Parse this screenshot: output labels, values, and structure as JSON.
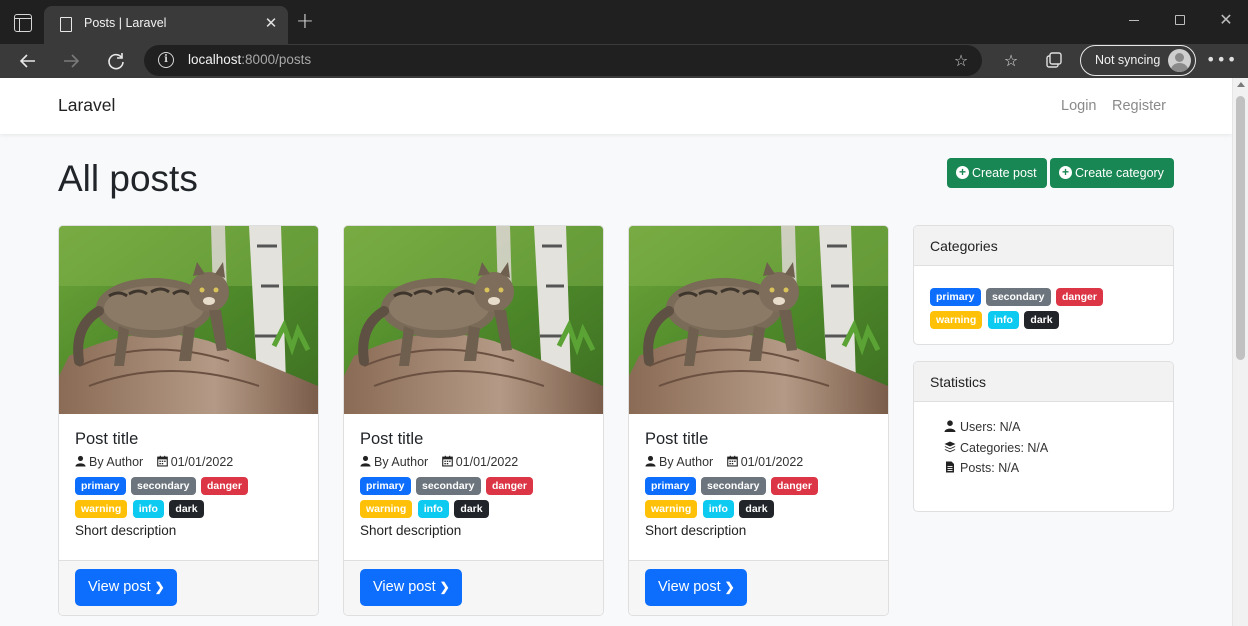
{
  "browser": {
    "tab_title": "Posts | Laravel",
    "url_host": "localhost",
    "url_rest": ":8000/posts",
    "profile_label": "Not syncing"
  },
  "navbar": {
    "brand": "Laravel",
    "login": "Login",
    "register": "Register"
  },
  "page": {
    "title": "All posts",
    "create_post": "Create post",
    "create_category": "Create category"
  },
  "posts": [
    {
      "title": "Post title",
      "author": "By Author",
      "date": "01/01/2022",
      "description": "Short description",
      "button": "View post"
    },
    {
      "title": "Post title",
      "author": "By Author",
      "date": "01/01/2022",
      "description": "Short description",
      "button": "View post"
    },
    {
      "title": "Post title",
      "author": "By Author",
      "date": "01/01/2022",
      "description": "Short description",
      "button": "View post"
    }
  ],
  "badges": [
    "primary",
    "secondary",
    "danger",
    "warning",
    "info",
    "dark"
  ],
  "sidebar": {
    "categories_title": "Categories",
    "statistics_title": "Statistics",
    "stats": {
      "users": "Users: N/A",
      "categories": "Categories: N/A",
      "posts": "Posts: N/A"
    }
  },
  "colors": {
    "primary": "#0d6efd",
    "secondary": "#6c757d",
    "danger": "#dc3545",
    "warning": "#ffc107",
    "info": "#0dcaf0",
    "dark": "#212529",
    "success": "#198754"
  }
}
